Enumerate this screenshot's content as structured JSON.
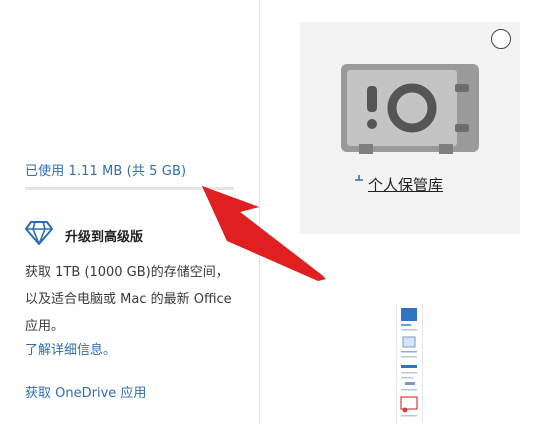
{
  "sidebar": {
    "storage": {
      "link_text": "已使用 1.11 MB (共 5 GB)",
      "used_fraction": 0.0002
    },
    "upgrade": {
      "icon": "diamond-icon",
      "title": "升级到高级版",
      "description": "获取 1TB (1000 GB)的存储空间，以及适合电脑或 Mac 的最新 Office 应用。",
      "learn_more": "了解详细信息。"
    },
    "get_app_link": "获取 OneDrive 应用"
  },
  "main": {
    "vault_tile": {
      "label": "个人保管库",
      "icon": "safe-vault-icon",
      "checkbox_icon": "circle-select-icon"
    },
    "document_thumbnail": {
      "icon": "document-thumbnail"
    }
  },
  "annotation": {
    "arrow_icon": "red-arrow-icon",
    "color": "#e02020"
  },
  "colors": {
    "link": "#2f6db0",
    "tile_background": "#f3f3f3",
    "divider": "#e1e1e1"
  }
}
